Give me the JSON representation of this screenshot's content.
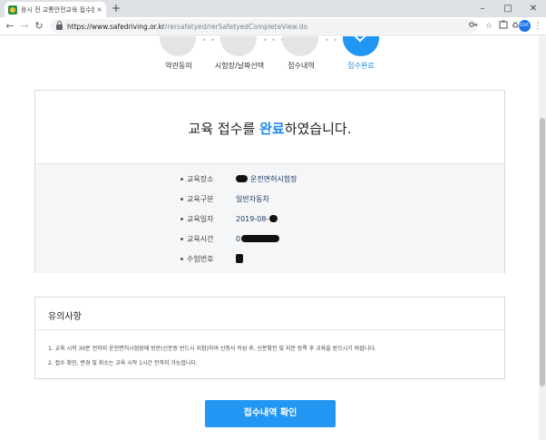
{
  "browser": {
    "tab_title": "응시 전 교통안전교육 접수완료",
    "tab_close": "×",
    "new_tab": "+",
    "window_controls": [
      "–",
      "□",
      "✕"
    ],
    "nav": {
      "back": "←",
      "forward": "→",
      "reload": "↻"
    },
    "url_host": "https://www.safedriving.or.kr",
    "url_path": "/rersafetyed/rerSafetyedCompleteView.do",
    "toolbar_icons": [
      "key-icon",
      "star-icon",
      "extensions-icon",
      "recycle-icon",
      "menu-icon"
    ],
    "profile_initials": "GVC"
  },
  "steps": [
    {
      "label": "약관동의",
      "state": "done"
    },
    {
      "label": "시험장/날짜선택",
      "state": "done"
    },
    {
      "label": "접수내역",
      "state": "done"
    },
    {
      "label": "접수완료",
      "state": "active"
    }
  ],
  "complete": {
    "title_pre": "교육 접수를 ",
    "title_highlight": "완료",
    "title_post": "하였습니다.",
    "rows": [
      {
        "label": "교육장소",
        "value": "운전면허시험장"
      },
      {
        "label": "교육구분",
        "value": "일반자동차"
      },
      {
        "label": "교육일자",
        "value": "2019-08-"
      },
      {
        "label": "교육시간",
        "value": "0"
      },
      {
        "label": "수험번호",
        "value": ""
      }
    ]
  },
  "notice": {
    "title": "유의사항",
    "lines": [
      "1. 교육 시작 30분 전까지 운전면허시험장에 방문(신분증 반드시 지참)하여 신청서 작성 후, 신분확인 및 지문 등록 후 교육을 받으시기 바랍니다.",
      "2. 접수 확인, 변경 및 취소는 교육 시작 1시간 전까지 가능합니다."
    ]
  },
  "confirm_button": "접수내역 확인",
  "colors": {
    "accent": "#2196f3",
    "highlight": "#1e88e5",
    "value_text": "#1f3b63"
  }
}
